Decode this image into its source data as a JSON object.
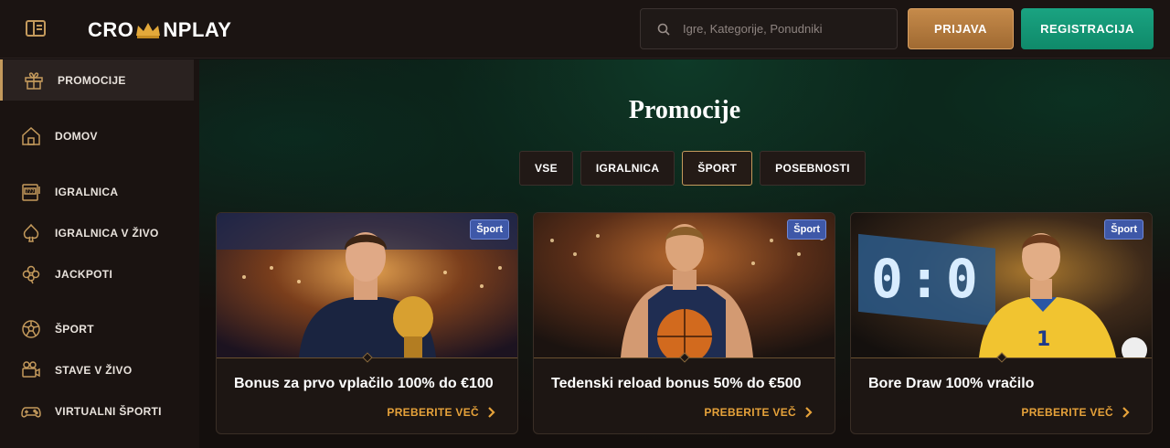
{
  "header": {
    "logo_left": "CRO",
    "logo_right": "NPLAY",
    "search_placeholder": "Igre, Kategorije, Ponudniki",
    "login_label": "PRIJAVA",
    "register_label": "REGISTRACIJA"
  },
  "sidebar": {
    "items": [
      {
        "label": "PROMOCIJE",
        "icon": "gift-icon"
      },
      {
        "label": "DOMOV",
        "icon": "home-icon"
      },
      {
        "label": "IGRALNICA",
        "icon": "slot-machine-icon"
      },
      {
        "label": "IGRALNICA V ŽIVO",
        "icon": "spade-icon"
      },
      {
        "label": "JACKPOTI",
        "icon": "clover-icon"
      },
      {
        "label": "ŠPORT",
        "icon": "soccer-ball-icon"
      },
      {
        "label": "STAVE V ŽIVO",
        "icon": "live-camera-icon"
      },
      {
        "label": "VIRTUALNI ŠPORTI",
        "icon": "gamepad-icon"
      }
    ]
  },
  "main": {
    "title": "Promocije",
    "tabs": [
      "VSE",
      "IGRALNICA",
      "ŠPORT",
      "POSEBNOSTI"
    ],
    "active_tab": "ŠPORT",
    "cards": [
      {
        "tag": "Šport",
        "title": "Bonus za prvo vplačilo 100% do €100",
        "cta": "PREBERITE VEČ"
      },
      {
        "tag": "Šport",
        "title": "Tedenski reload bonus 50% do €500",
        "cta": "PREBERITE VEČ"
      },
      {
        "tag": "Šport",
        "title": "Bore Draw 100% vračilo",
        "cta": "PREBERITE VEČ"
      }
    ],
    "scoreboard": "0:0",
    "jersey_number": "1"
  },
  "colors": {
    "accent_gold": "#c49a5c",
    "login_bg": "#b07a3e",
    "register_bg": "#14997a",
    "cta_orange": "#e6a23a",
    "tag_blue": "#3e58a8"
  }
}
